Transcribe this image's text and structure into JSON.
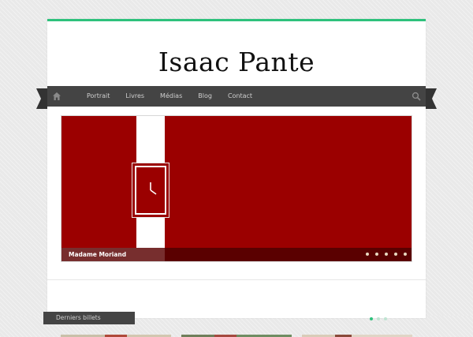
{
  "site": {
    "title": "Isaac Pante"
  },
  "nav": {
    "home_icon": "home-icon",
    "search_icon": "search-icon",
    "items": [
      "Portrait",
      "Livres",
      "Médias",
      "Blog",
      "Contact"
    ]
  },
  "slider": {
    "caption": "Madame Moriand",
    "slide_count": 5,
    "current_slide": 1
  },
  "latest": {
    "label": "Derniers billets",
    "page_dots": 3,
    "active_dot": 1
  },
  "colors": {
    "accent": "#2ec17c",
    "nav_bg": "#444444",
    "slide_bg": "#9b0000"
  }
}
